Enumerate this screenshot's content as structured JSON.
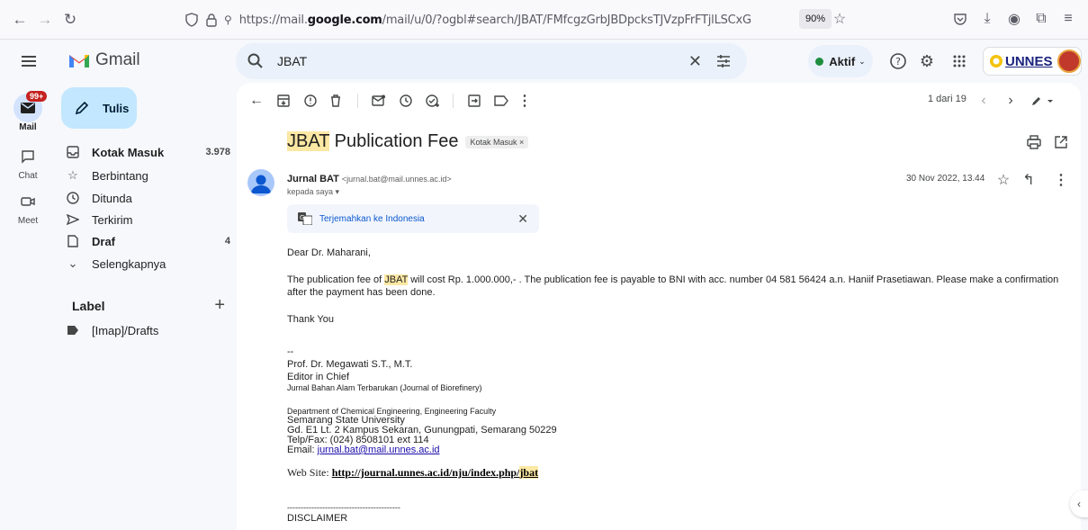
{
  "browser": {
    "url_prefix": "https://mail.",
    "url_domain": "google.com",
    "url_path": "/mail/u/0/?ogbl#search/JBAT/FMfcgzGrbJBDpcksTJVzpFrFTjlLSCxG",
    "zoom": "90%"
  },
  "header": {
    "app_name": "Gmail",
    "search_value": "JBAT",
    "status_label": "Aktif",
    "brand_text": "UNNES"
  },
  "rail": {
    "mail_label": "Mail",
    "mail_badge": "99+",
    "chat_label": "Chat",
    "meet_label": "Meet"
  },
  "sidebar": {
    "compose_label": "Tulis",
    "items": [
      {
        "label": "Kotak Masuk",
        "count": "3.978",
        "icon": "inbox-icon"
      },
      {
        "label": "Berbintang",
        "count": "",
        "icon": "star-icon"
      },
      {
        "label": "Ditunda",
        "count": "",
        "icon": "clock-icon"
      },
      {
        "label": "Terkirim",
        "count": "",
        "icon": "send-icon"
      },
      {
        "label": "Draf",
        "count": "4",
        "icon": "draft-icon"
      },
      {
        "label": "Selengkapnya",
        "count": "",
        "icon": "chevron-down-icon"
      }
    ],
    "labels_heading": "Label",
    "labels": [
      {
        "label": "[Imap]/Drafts"
      }
    ]
  },
  "toolbar": {
    "pager": "1 dari 19"
  },
  "email": {
    "subject_highlight": "JBAT",
    "subject_rest": " Publication Fee",
    "chip": "Kotak Masuk ×",
    "sender_name": "Jurnal BAT",
    "sender_addr": "<jurnal.bat@mail.unnes.ac.id>",
    "to_line": "kepada saya ▾",
    "date": "30 Nov 2022, 13.44",
    "translate": "Terjemahkan ke Indonesia",
    "greeting": "Dear Dr. Maharani,",
    "para1_a": "The publication fee of ",
    "para1_hl": "JBAT",
    "para1_b": " will cost Rp. 1.000.000,- .  The publication fee is payable to BNI with acc. number 04 581 56424 a.n. Haniif Prasetiawan. Please make a confirmation after the payment has been done.",
    "thanks": "Thank You",
    "dashes": "--",
    "sig_name": "Prof. Dr. Megawati S.T., M.T.",
    "sig_role": "Editor in Chief",
    "sig_journal": "Jurnal Bahan Alam Terbarukan (Journal of Biorefinery)",
    "addr_dept": "Department of Chemical Engineering, Engineering Faculty",
    "addr_univ": "Semarang State University",
    "addr_street": "Gd. E1 Lt. 2 Kampus Sekaran, Gunungpati, Semarang 50229",
    "addr_phone": "Telp/Fax: (024) 8508101 ext 114",
    "email_label": "Email: ",
    "email_link": "jurnal.bat@mail.unnes.ac.id",
    "web_label": "Web Site: ",
    "web_link": "http://journal.unnes.ac.id/nju/index.php/",
    "web_link_hl": "jbat",
    "rule": "------------------------------------------",
    "disclaimer": "DISCLAIMER"
  }
}
